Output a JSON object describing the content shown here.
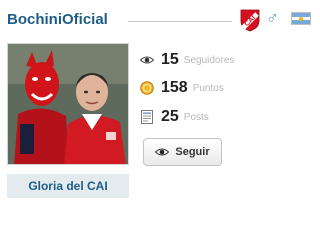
{
  "profile": {
    "username": "BochiniOficial",
    "avatar_caption": "Gloria del CAI"
  },
  "stats": [
    {
      "value": "15",
      "label": "Seguidores",
      "icon": "eye-icon"
    },
    {
      "value": "158",
      "label": "Puntos",
      "icon": "points-coin-icon"
    },
    {
      "value": "25",
      "label": "Posts",
      "icon": "posts-document-icon"
    }
  ],
  "actions": {
    "follow_label": "Seguir"
  },
  "badges": {
    "club": "CAI",
    "gender": "♂"
  },
  "colors": {
    "brand_blue": "#1e5d86",
    "club_red": "#d6101f",
    "caption_bg": "#e4ebef"
  }
}
